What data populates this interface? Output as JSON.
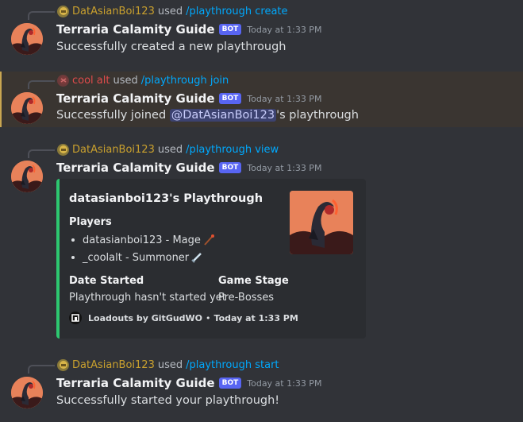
{
  "messages": [
    {
      "reply": {
        "user": "DatAsianBoi123",
        "used": "used",
        "command": "/playthrough create"
      },
      "author": "Terraria Calamity Guide",
      "bot_tag": "BOT",
      "timestamp": "Today at 1:33 PM",
      "content": "Successfully created a new playthrough"
    },
    {
      "reply": {
        "user": "cool alt",
        "used": "used",
        "command": "/playthrough join"
      },
      "author": "Terraria Calamity Guide",
      "bot_tag": "BOT",
      "timestamp": "Today at 1:33 PM",
      "content_pre": "Successfully joined ",
      "mention": "@DatAsianBoi123",
      "content_post": "'s playthrough"
    },
    {
      "reply": {
        "user": "DatAsianBoi123",
        "used": "used",
        "command": "/playthrough view"
      },
      "author": "Terraria Calamity Guide",
      "bot_tag": "BOT",
      "timestamp": "Today at 1:33 PM",
      "embed": {
        "color": "#2dc770",
        "title": "datasianboi123's Playthrough",
        "players_label": "Players",
        "players": [
          "datasianboi123 - Mage",
          "_coolalt - Summoner"
        ],
        "date_started_label": "Date Started",
        "date_started_value": "Playthrough hasn't started yet",
        "game_stage_label": "Game Stage",
        "game_stage_value": "Pre-Bosses",
        "footer_text": "Loadouts by GitGudWO",
        "footer_separator": "•",
        "footer_time": "Today at 1:33 PM"
      }
    },
    {
      "reply": {
        "user": "DatAsianBoi123",
        "used": "used",
        "command": "/playthrough start"
      },
      "author": "Terraria Calamity Guide",
      "bot_tag": "BOT",
      "timestamp": "Today at 1:33 PM",
      "content": "Successfully started your playthrough!"
    }
  ],
  "icons": {
    "avatar": "calamity-avatar-icon",
    "mage": "staff-icon",
    "summoner": "sword-icon",
    "footer": "gitgud-icon"
  },
  "colors": {
    "background": "#313338",
    "bot_tag": "#5865f2",
    "command": "#00a8fc",
    "mention": "#c9cdfb",
    "highlight_bar": "#c9a651",
    "embed_bar": "#2dc770"
  }
}
